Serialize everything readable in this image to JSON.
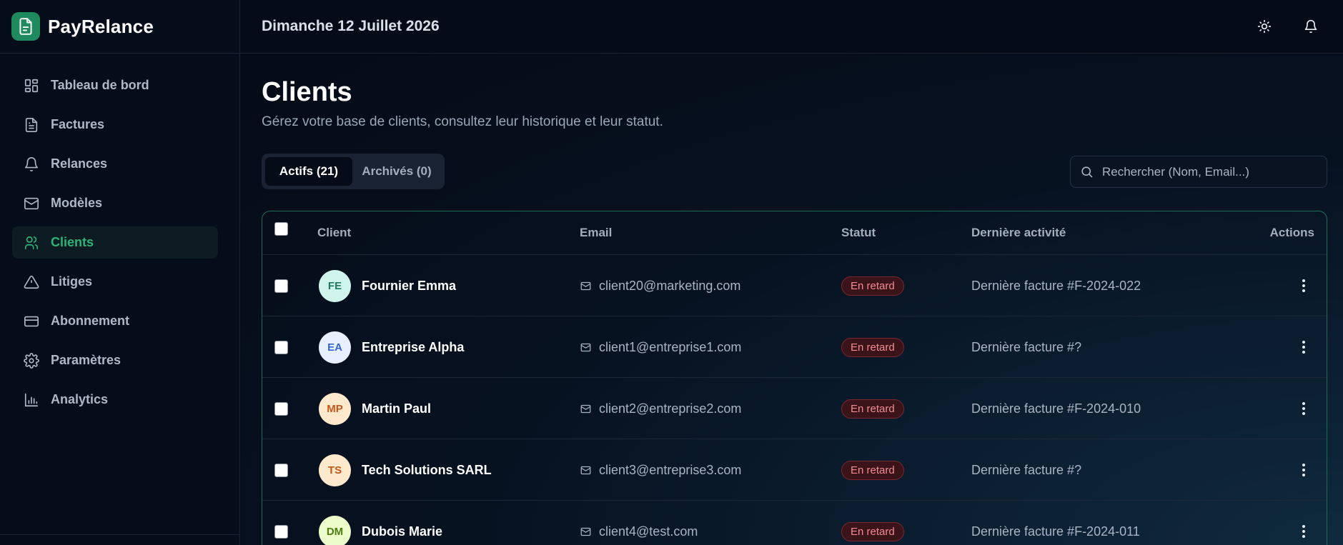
{
  "app": {
    "name": "PayRelance"
  },
  "header": {
    "date": "Dimanche 12 Juillet 2026"
  },
  "sidebar": {
    "items": [
      {
        "label": "Tableau de bord",
        "icon": "dashboard-icon"
      },
      {
        "label": "Factures",
        "icon": "file-text-icon"
      },
      {
        "label": "Relances",
        "icon": "bell-icon"
      },
      {
        "label": "Modèles",
        "icon": "mail-icon"
      },
      {
        "label": "Clients",
        "icon": "users-icon",
        "active": true
      },
      {
        "label": "Litiges",
        "icon": "alert-triangle-icon"
      },
      {
        "label": "Abonnement",
        "icon": "credit-card-icon"
      },
      {
        "label": "Paramètres",
        "icon": "gear-icon"
      },
      {
        "label": "Analytics",
        "icon": "bar-chart-icon"
      }
    ]
  },
  "page": {
    "title": "Clients",
    "subtitle": "Gérez votre base de clients, consultez leur historique et leur statut."
  },
  "tabs": [
    {
      "label": "Actifs (21)",
      "active": true
    },
    {
      "label": "Archivés (0)",
      "active": false
    }
  ],
  "search": {
    "placeholder": "Rechercher (Nom, Email...)"
  },
  "table": {
    "headers": {
      "client": "Client",
      "email": "Email",
      "status": "Statut",
      "activity": "Dernière activité",
      "actions": "Actions"
    },
    "rows": [
      {
        "initials": "FE",
        "name": "Fournier Emma",
        "email": "client20@marketing.com",
        "status": "En retard",
        "activity": "Dernière facture #F-2024-022"
      },
      {
        "initials": "EA",
        "name": "Entreprise Alpha",
        "email": "client1@entreprise1.com",
        "status": "En retard",
        "activity": "Dernière facture #?"
      },
      {
        "initials": "MP",
        "name": "Martin Paul",
        "email": "client2@entreprise2.com",
        "status": "En retard",
        "activity": "Dernière facture #F-2024-010"
      },
      {
        "initials": "TS",
        "name": "Tech Solutions SARL",
        "email": "client3@entreprise3.com",
        "status": "En retard",
        "activity": "Dernière facture #?"
      },
      {
        "initials": "DM",
        "name": "Dubois Marie",
        "email": "client4@test.com",
        "status": "En retard",
        "activity": "Dernière facture #F-2024-011"
      }
    ]
  },
  "colors": {
    "accent": "#2fb478",
    "brand": "#1f8a5e",
    "status_late": "#f58a93",
    "avatar_fe_bg": "#cff5ec",
    "avatar_fe_fg": "#1f7a5e",
    "avatar_ea_bg": "#e8f0ff",
    "avatar_ea_fg": "#3366cc",
    "avatar_mp_bg": "#ffe9cc",
    "avatar_mp_fg": "#c2571a",
    "avatar_ts_bg": "#ffe9cc",
    "avatar_ts_fg": "#c2571a",
    "avatar_dm_bg": "#ecfccb",
    "avatar_dm_fg": "#4d7c0f"
  }
}
